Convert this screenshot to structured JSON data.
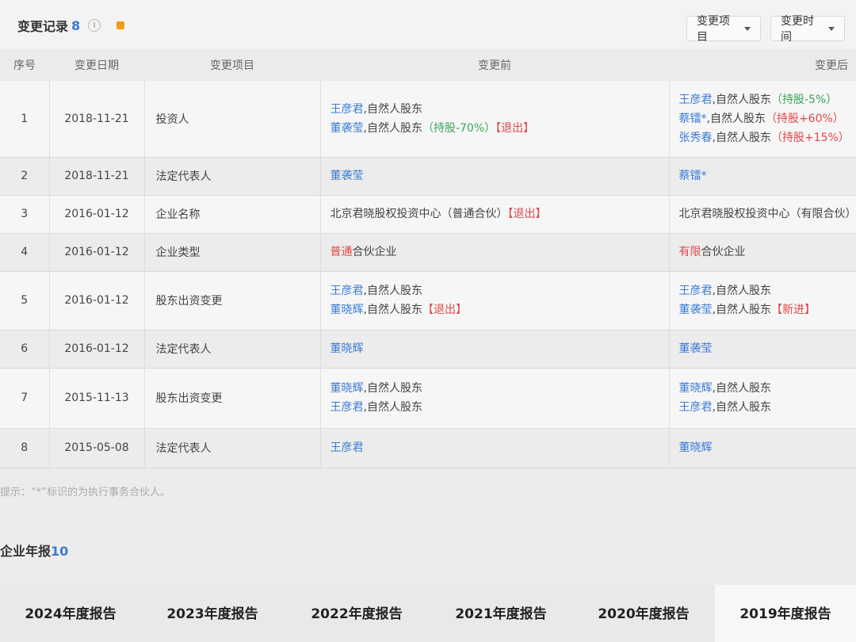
{
  "section": {
    "title": "变更记录",
    "count": "8"
  },
  "filters": {
    "item_label": "变更项目",
    "time_label": "变更时间"
  },
  "table": {
    "headers": [
      "序号",
      "变更日期",
      "变更项目",
      "变更前",
      "变更后"
    ],
    "rows": [
      {
        "no": "1",
        "date": "2018-11-21",
        "item": "投资人",
        "before": [
          {
            "name": "王彦君",
            "desc": ",自然人股东",
            "tag": "",
            "tag_color": ""
          },
          {
            "name": "董袭莹",
            "desc": ",自然人股东",
            "tag": "（持股-70%）",
            "tag_color": "green",
            "tag2": "【退出】"
          }
        ],
        "after": [
          {
            "name": "王彦君",
            "desc": ",自然人股东",
            "tag": "（持股-5%）",
            "tag_color": "green"
          },
          {
            "name": "蔡镭*",
            "desc": ",自然人股东",
            "tag": "（持股+60%）",
            "tag_color": "red"
          },
          {
            "name": "张秀春",
            "desc": ",自然人股东",
            "tag": "（持股+15%）",
            "tag_color": "red"
          }
        ]
      },
      {
        "no": "2",
        "date": "2018-11-21",
        "item": "法定代表人",
        "before": [
          {
            "name": "董袭莹",
            "desc": "",
            "tag": "",
            "tag_color": ""
          }
        ],
        "after": [
          {
            "name": "蔡镭*",
            "desc": "",
            "tag": "",
            "tag_color": ""
          }
        ]
      },
      {
        "no": "3",
        "date": "2016-01-12",
        "item": "企业名称",
        "before_text": "北京君晓股权投资中心（普通合伙）",
        "before_tag": "【退出】",
        "after_text": "北京君晓股权投资中心（有限合伙）"
      },
      {
        "no": "4",
        "date": "2016-01-12",
        "item": "企业类型",
        "before_hl": "普通",
        "before_rest": "合伙企业",
        "after_hl": "有限",
        "after_rest": "合伙企业"
      },
      {
        "no": "5",
        "date": "2016-01-12",
        "item": "股东出资变更",
        "before": [
          {
            "name": "王彦君",
            "desc": ",自然人股东",
            "tag": "",
            "tag_color": ""
          },
          {
            "name": "董晓辉",
            "desc": ",自然人股东",
            "tag": "【退出】",
            "tag_color": "red"
          }
        ],
        "after": [
          {
            "name": "王彦君",
            "desc": ",自然人股东",
            "tag": "",
            "tag_color": ""
          },
          {
            "name": "董袭莹",
            "desc": ",自然人股东",
            "tag": "【新进】",
            "tag_color": "red"
          }
        ]
      },
      {
        "no": "6",
        "date": "2016-01-12",
        "item": "法定代表人",
        "before": [
          {
            "name": "董晓辉",
            "desc": "",
            "tag": "",
            "tag_color": ""
          }
        ],
        "after": [
          {
            "name": "董袭莹",
            "desc": "",
            "tag": "",
            "tag_color": ""
          }
        ]
      },
      {
        "no": "7",
        "date": "2015-11-13",
        "item": "股东出资变更",
        "before": [
          {
            "name": "董晓辉",
            "desc": ",自然人股东",
            "tag": "",
            "tag_color": ""
          },
          {
            "name": "王彦君",
            "desc": ",自然人股东",
            "tag": "",
            "tag_color": ""
          }
        ],
        "after": [
          {
            "name": "董晓辉",
            "desc": ",自然人股东",
            "tag": "",
            "tag_color": ""
          },
          {
            "name": "王彦君",
            "desc": ",自然人股东",
            "tag": "",
            "tag_color": ""
          }
        ]
      },
      {
        "no": "8",
        "date": "2015-05-08",
        "item": "法定代表人",
        "before": [
          {
            "name": "王彦君",
            "desc": "",
            "tag": "",
            "tag_color": ""
          }
        ],
        "after": [
          {
            "name": "董晓辉",
            "desc": "",
            "tag": "",
            "tag_color": ""
          }
        ]
      }
    ]
  },
  "note": "提示：“*”标识的为执行事务合伙人。",
  "reports": {
    "title": "企业年报",
    "count": "10",
    "items": [
      {
        "label": "2024年度报告"
      },
      {
        "label": "2023年度报告"
      },
      {
        "label": "2022年度报告"
      },
      {
        "label": "2021年度报告"
      },
      {
        "label": "2020年度报告"
      },
      {
        "label": "2019年度报告"
      }
    ]
  },
  "colors": {
    "link": "#3a7bd5",
    "red_tag": "#e04848",
    "green_tag": "#3aa55a"
  }
}
